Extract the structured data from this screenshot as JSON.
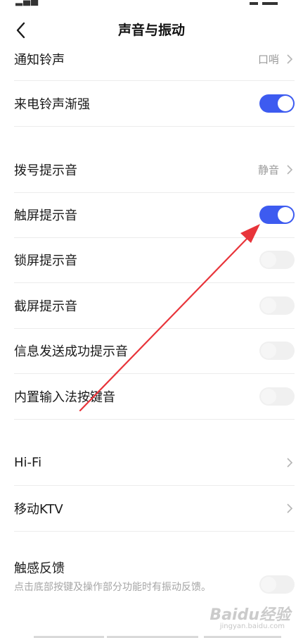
{
  "header": {
    "title": "声音与振动"
  },
  "rows": {
    "notify_ringtone": {
      "label": "通知铃声",
      "value": "口哨"
    },
    "ring_crescendo": {
      "label": "来电铃声渐强"
    },
    "dial_tone": {
      "label": "拨号提示音",
      "value": "静音"
    },
    "touch_tone": {
      "label": "触屏提示音"
    },
    "lock_tone": {
      "label": "锁屏提示音"
    },
    "screenshot_tone": {
      "label": "截屏提示音"
    },
    "msg_sent_tone": {
      "label": "信息发送成功提示音"
    },
    "ime_key_tone": {
      "label": "内置输入法按键音"
    },
    "hifi": {
      "label": "Hi-Fi"
    },
    "mobile_ktv": {
      "label": "移动KTV"
    },
    "haptic": {
      "label": "触感反馈",
      "description": "点击底部按键及操作部分功能时有振动反馈。"
    }
  },
  "toggles": {
    "ring_crescendo": true,
    "touch_tone": true,
    "lock_tone": false,
    "screenshot_tone": false,
    "msg_sent_tone": false,
    "ime_key_tone": false,
    "haptic": false
  },
  "watermark": {
    "brand": "Baidu经验",
    "url": "jingyan.baidu.com"
  },
  "colors": {
    "accent": "#3d5bf0",
    "arrow": "#e8343a"
  },
  "icons": {
    "back": "chevron-left-icon",
    "chevron": "chevron-right-icon"
  }
}
